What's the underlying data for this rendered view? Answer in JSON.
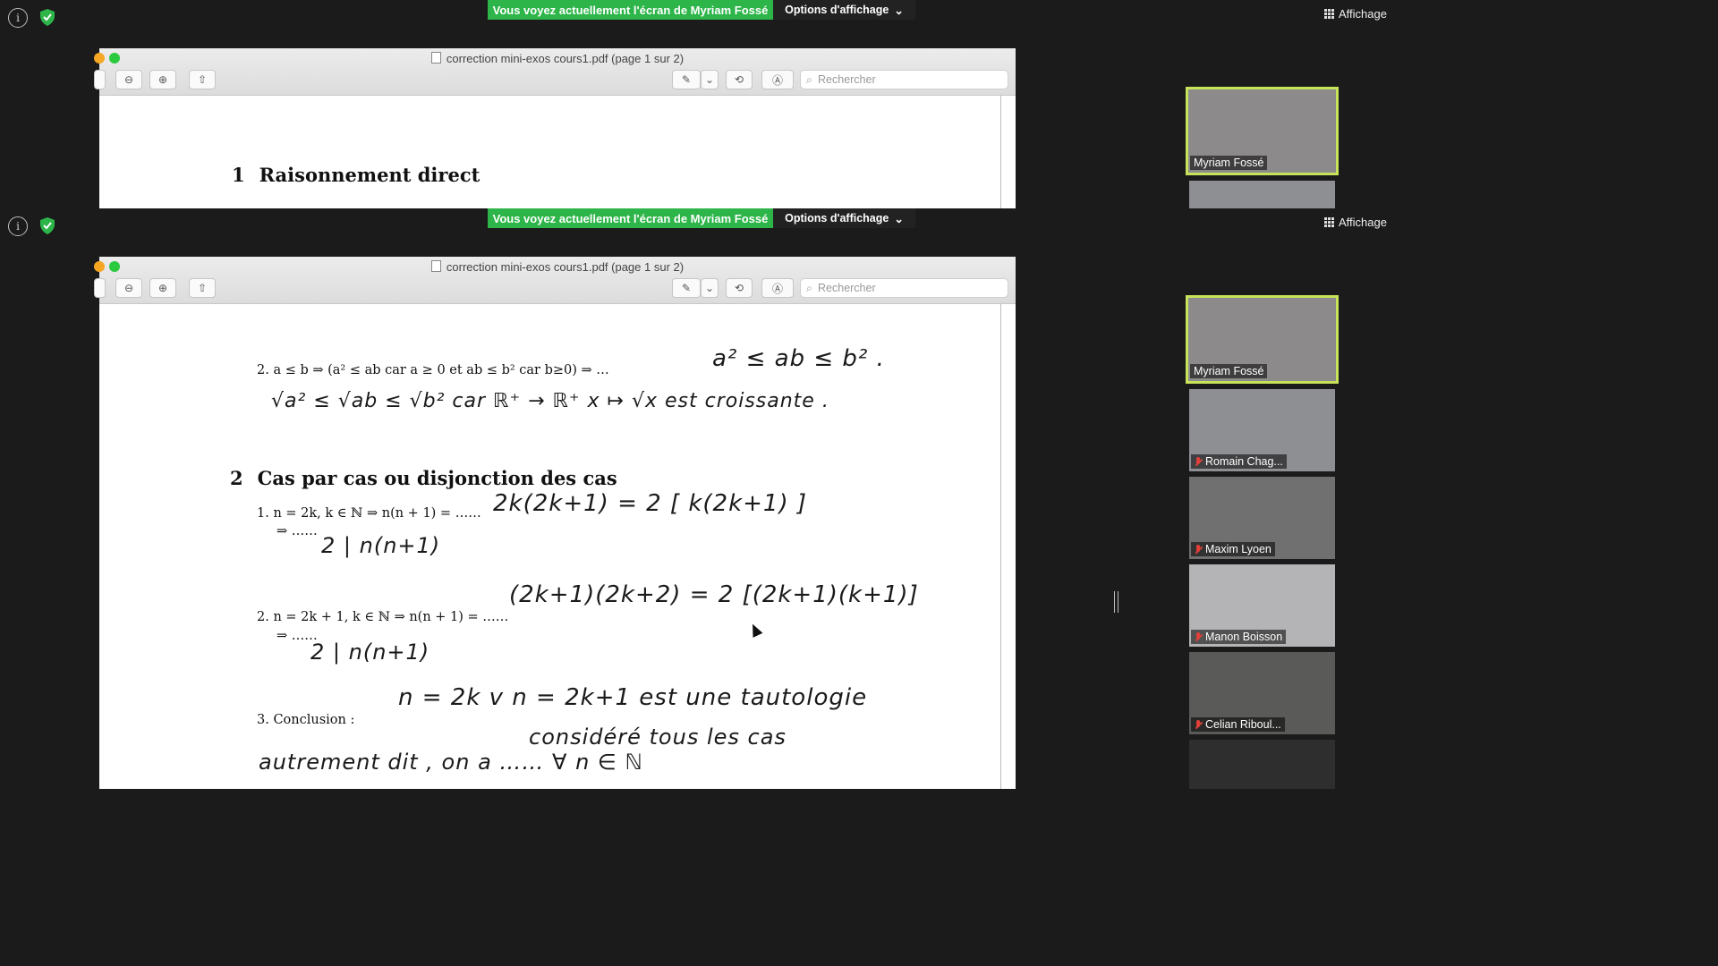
{
  "banner": {
    "message": "Vous voyez actuellement l'écran de Myriam Fossé",
    "options_label": "Options d'affichage"
  },
  "view_button": {
    "label": "Affichage"
  },
  "pdf": {
    "title": "correction mini-exos cours1.pdf (page 1 sur 2)",
    "search_placeholder": "Rechercher"
  },
  "document": {
    "section1": {
      "number": "1",
      "title": "Raisonnement direct"
    },
    "section2": {
      "number": "2",
      "title": "Cas par cas ou disjonction des cas"
    },
    "item_direct_2": "2.  a ≤ b ⇒ (a² ≤ ab car a ≥ 0  et ab ≤ b²  car b≥0) ⇒ …",
    "hand_direct_2a": "a² ≤ ab ≤ b² .",
    "hand_direct_2b": "√a² ≤ √ab ≤ √b²   car   ℝ⁺ → ℝ⁺  x ↦ √x   est croissante .",
    "case1": "1.  n = 2k, k ∈ ℕ ⇒ n(n + 1) = ……",
    "case1_hand": "2k(2k+1) = 2 [ k(2k+1) ]",
    "case1_arrow": "⇒ ……",
    "case1_result": "2 | n(n+1)",
    "case2": "2.  n = 2k + 1, k ∈ ℕ ⇒ n(n + 1) = ……",
    "case2_hand": "(2k+1)(2k+2) = 2 [(2k+1)(k+1)]",
    "case2_arrow": "⇒ ……",
    "case2_result": "2 | n(n+1)",
    "case3": "3.  Conclusion :",
    "case3_hand": "n = 2k  v  n = 2k+1   est une tautologie",
    "conclusion_line2": "considéré tous les cas",
    "conclusion_line3": "autrement dit , on a  ……  ∀ n ∈ ℕ"
  },
  "participants": [
    {
      "name": "Myriam Fossé",
      "muted": false,
      "active": true,
      "bg": "#8c8a8a"
    },
    {
      "name": "Romain Chag...",
      "muted": true,
      "active": false,
      "bg": "#8e8f92"
    },
    {
      "name": "Maxim Lyoen",
      "muted": true,
      "active": false,
      "bg": "#6f706f"
    },
    {
      "name": "Manon Boisson",
      "muted": true,
      "active": false,
      "bg": "#b4b3b6"
    },
    {
      "name": "Celian Riboul...",
      "muted": true,
      "active": false,
      "bg": "#5a5a58"
    },
    {
      "name": "",
      "muted": false,
      "active": false,
      "bg": "#2e2e2e"
    }
  ],
  "colors": {
    "banner_green": "#2db54a",
    "active_border": "#c6e35a",
    "muted_red": "#e0403a"
  }
}
